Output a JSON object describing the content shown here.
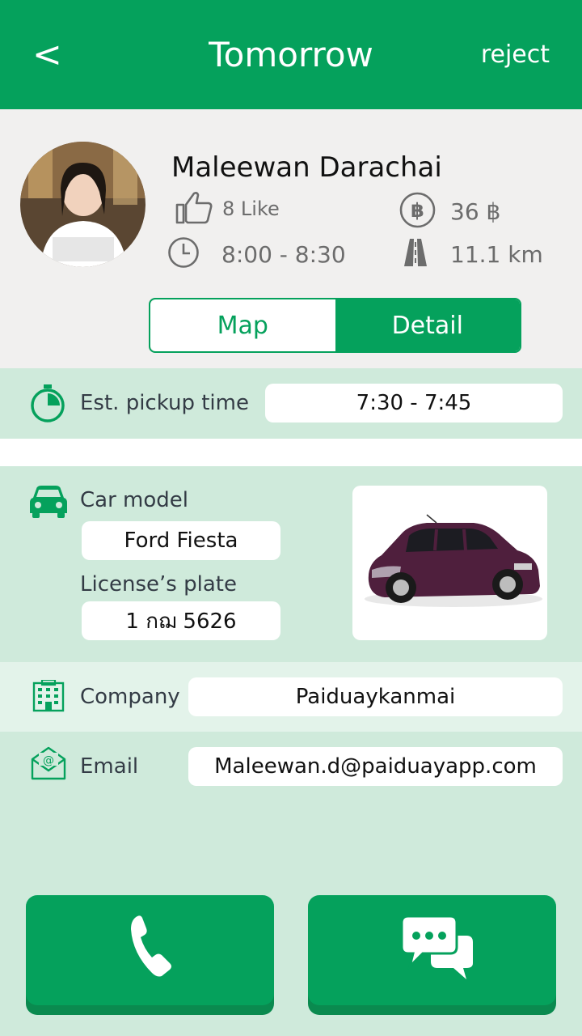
{
  "header": {
    "back_label": "<",
    "title": "Tomorrow",
    "reject_label": "reject"
  },
  "profile": {
    "name": "Maleewan Darachai",
    "likes": "8 Like",
    "price": "36 ฿",
    "time": "8:00 - 8:30",
    "distance": "11.1 km"
  },
  "tabs": {
    "map_label": "Map",
    "detail_label": "Detail",
    "active": "Detail"
  },
  "details": {
    "pickup_label": "Est. pickup time",
    "pickup_value": "7:30 - 7:45",
    "car_model_label": "Car model",
    "car_model_value": "Ford Fiesta",
    "plate_label": "License’s plate",
    "plate_value": "1 กฌ 5626",
    "company_label": "Company",
    "company_value": "Paiduaykanmai",
    "email_label": "Email",
    "email_value": "Maleewan.d@paiduayapp.com"
  },
  "actions": {
    "call_icon": "phone-icon",
    "chat_icon": "chat-bubbles-icon"
  },
  "colors": {
    "brand_green": "#05a15c",
    "mint_bg": "#cfeadb",
    "light_mint": "#e3f3ea",
    "profile_bg": "#f1f0ef"
  }
}
